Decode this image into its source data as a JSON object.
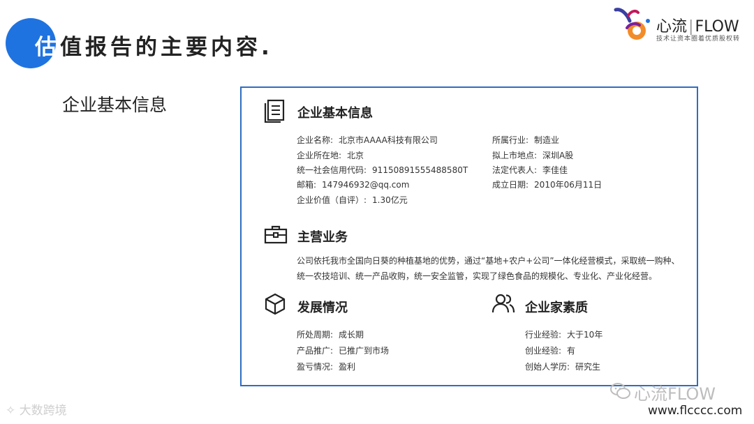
{
  "header": {
    "title_first_char": "估",
    "title_rest": "值报告的主要内容.",
    "logo_name": "心流",
    "logo_name_en": "FLOW",
    "logo_slogan": "技术让资本圈着优质股权转",
    "accent_color": "#1f73e0"
  },
  "section_label": "企业基本信息",
  "card": {
    "border_color": "#2e6cc2",
    "basic": {
      "title": "企业基本信息",
      "icon": "document-icon",
      "left": [
        {
          "label": "企业名称:",
          "value": "北京市AAAA科技有限公司"
        },
        {
          "label": "企业所在地:",
          "value": "北京"
        },
        {
          "label": "统一社会信用代码:",
          "value": "91150891555488580T"
        },
        {
          "label": "邮箱:",
          "value": "147946932@qq.com"
        },
        {
          "label": "企业价值（自评）:",
          "value": "1.30亿元"
        }
      ],
      "right": [
        {
          "label": "所属行业:",
          "value": "制造业"
        },
        {
          "label": "拟上市地点:",
          "value": "深圳A股"
        },
        {
          "label": "法定代表人:",
          "value": "李佳佳"
        },
        {
          "label": "成立日期:",
          "value": "2010年06月11日"
        }
      ]
    },
    "business": {
      "title": "主营业务",
      "icon": "briefcase-icon",
      "text": "公司依托我市全国向日葵的种植基地的优势，通过“基地+农户+公司”一体化经营模式，采取统一购种、统一农技培训、统一产品收购，统一安全监管，实现了绿色食品的规模化、专业化、产业化经营。"
    },
    "development": {
      "title": "发展情况",
      "icon": "cube-icon",
      "rows": [
        {
          "label": "所处周期:",
          "value": "成长期"
        },
        {
          "label": "产品推广:",
          "value": "已推广到市场"
        },
        {
          "label": "盈亏情况:",
          "value": "盈利"
        }
      ]
    },
    "entrepreneur": {
      "title": "企业家素质",
      "icon": "users-icon",
      "rows": [
        {
          "label": "行业经验:",
          "value": "大于10年"
        },
        {
          "label": "创业经验:",
          "value": "有"
        },
        {
          "label": "创始人学历:",
          "value": "研究生"
        }
      ]
    }
  },
  "footer": {
    "left_watermark": "大数跨境",
    "wechat_watermark": "心流FLOW",
    "url": "www.flcccc.com"
  }
}
